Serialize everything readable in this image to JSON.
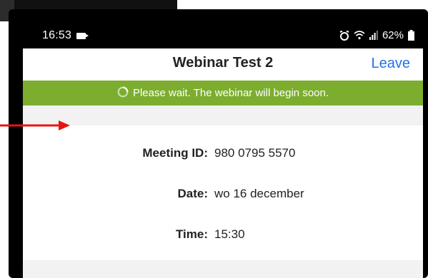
{
  "status_bar": {
    "time": "16:53",
    "battery": "62%",
    "icons": [
      "video-icon",
      "alarm-icon",
      "wifi-icon",
      "signal-icon",
      "battery-icon"
    ]
  },
  "header": {
    "title": "Webinar Test 2",
    "leave_label": "Leave"
  },
  "banner": {
    "message": "Please wait. The webinar will begin soon.",
    "icon": "spinner-icon",
    "color": "#7cad2f"
  },
  "meeting": {
    "id_label": "Meeting ID:",
    "id_value": "980 0795 5570",
    "date_label": "Date:",
    "date_value": "wo 16 december",
    "time_label": "Time:",
    "time_value": "15:30"
  },
  "colors": {
    "accent": "#1f74e8",
    "annotation_arrow": "#e8140f"
  }
}
